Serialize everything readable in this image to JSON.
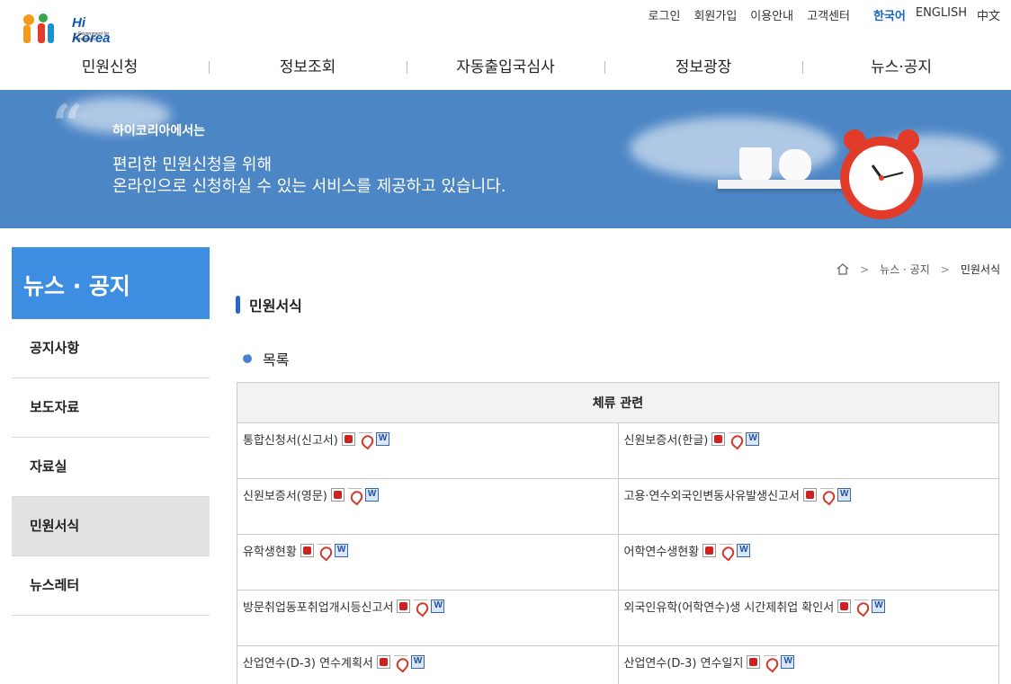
{
  "header": {
    "logo_text": "Hi Korea",
    "logo_sub": "e-Government for Foreigners",
    "util_links": [
      "로그인",
      "회원가입",
      "이용안내",
      "고객센터"
    ],
    "languages": [
      "한국어",
      "ENGLISH",
      "中文"
    ],
    "active_language": "한국어"
  },
  "gnb": [
    "민원신청",
    "정보조회",
    "자동출입국심사",
    "정보광장",
    "뉴스·공지"
  ],
  "banner": {
    "sub": "하이코리아에서는",
    "line1": "편리한 민원신청을 위해",
    "line2": "온라인으로 신청하실 수 있는 서비스를 제공하고 있습니다."
  },
  "sidebar": {
    "title": "뉴스 · 공지",
    "items": [
      {
        "label": "공지사항",
        "active": false
      },
      {
        "label": "보도자료",
        "active": false
      },
      {
        "label": "자료실",
        "active": false
      },
      {
        "label": "민원서식",
        "active": true
      },
      {
        "label": "뉴스레터",
        "active": false
      }
    ]
  },
  "breadcrumb": {
    "home_icon": "home-icon",
    "items": [
      "뉴스 · 공지",
      "민원서식"
    ]
  },
  "page_title": "민원서식",
  "section_title": "목록",
  "table": {
    "header": "체류 관련",
    "icons": [
      "hwp-file-icon",
      "pdf-file-icon",
      "doc-file-icon"
    ],
    "rows": [
      [
        "통합신청서(신고서)",
        "신원보증서(한글)"
      ],
      [
        "신원보증서(영문)",
        "고용·연수외국인변동사유발생신고서"
      ],
      [
        "유학생현황",
        "어학연수생현황"
      ],
      [
        "방문취업동포취업개시등신고서",
        "외국인유학(어학연수)생 시간제취업 확인서"
      ],
      [
        "산업연수(D-3) 연수계획서",
        "산업연수(D-3) 연수일지"
      ]
    ]
  },
  "colors": {
    "banner_bg": "#4d86c5",
    "sidebar_title_bg": "#3d8de0",
    "active_lang": "#1767c8"
  }
}
